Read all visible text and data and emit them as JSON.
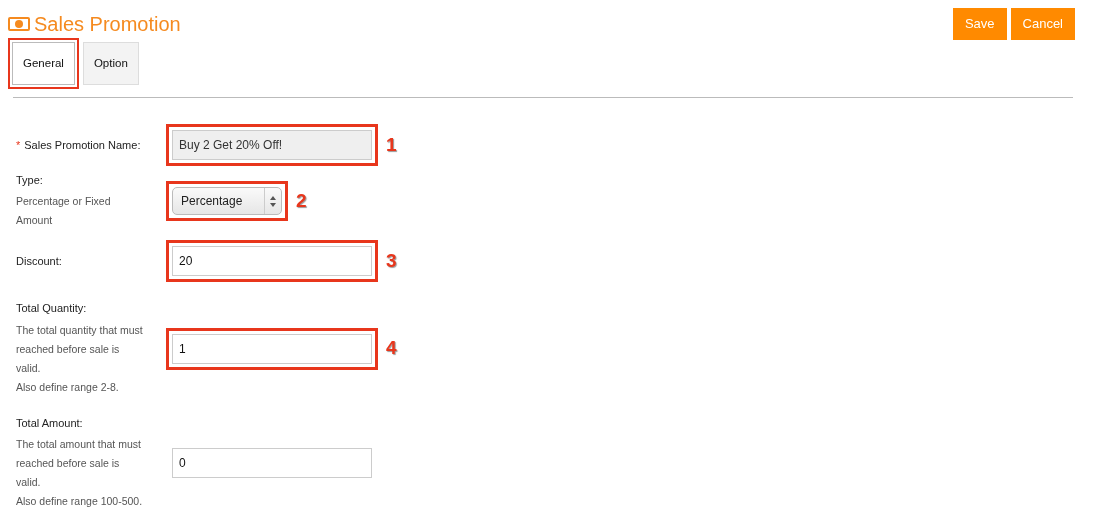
{
  "title": "Sales Promotion",
  "buttons": [
    {
      "label": "Save"
    },
    {
      "label": "Cancel"
    }
  ],
  "tabs": [
    {
      "label": "General",
      "selected": true,
      "highlighted": true
    },
    {
      "label": "Option",
      "selected": false,
      "highlighted": false
    }
  ],
  "fields": [
    {
      "required_mark": "*",
      "label": "Sales Promotion Name:",
      "kind": "text",
      "value": "Buy 2 Get 20% Off!",
      "disabled": true,
      "callout": "1"
    },
    {
      "label": "Type:",
      "hints": [
        "Percentage or Fixed Amount"
      ],
      "kind": "select",
      "value": "Percentage",
      "disabled": false,
      "callout": "2"
    },
    {
      "label": "Discount:",
      "kind": "text",
      "value": "20",
      "disabled": false,
      "callout": "3"
    },
    {
      "label": "Total Quantity:",
      "hints": [
        "The total quantity that must reached before sale is valid.",
        "Also define range 2-8."
      ],
      "kind": "text",
      "value": "1",
      "disabled": false,
      "callout": "4"
    },
    {
      "label": "Total Amount:",
      "hints": [
        "The total amount that must reached before sale is valid.",
        "Also define range 100-500."
      ],
      "kind": "text",
      "value": "0",
      "disabled": false
    }
  ]
}
